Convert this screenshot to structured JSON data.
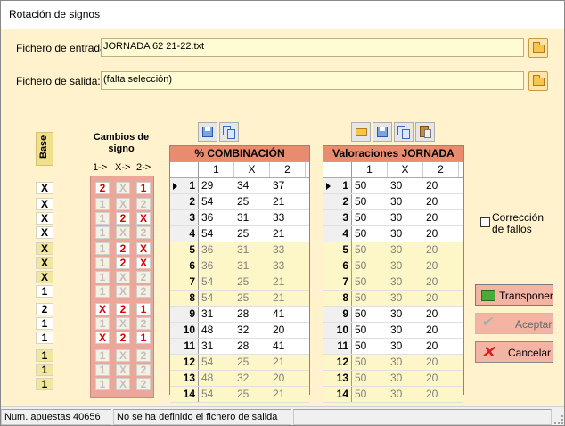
{
  "window": {
    "title": "Rotación de signos"
  },
  "files": {
    "input_label": "Fichero de entrada",
    "input_value": "JORNADA 62 21-22.txt",
    "output_label": "Fichero de salida:",
    "output_value": "(falta selección)"
  },
  "base": {
    "header": "Base",
    "values": [
      "X",
      "X",
      "X",
      "X",
      "X",
      "X",
      "X",
      "1",
      "2",
      "1",
      "1",
      "1",
      "1",
      "1"
    ]
  },
  "changes": {
    "header": "Cambios de signo",
    "col_labels": [
      "1->",
      "X->",
      "2->"
    ],
    "rows": [
      [
        "2",
        "X",
        "1"
      ],
      [
        "1",
        "X",
        "2"
      ],
      [
        "1",
        "2",
        "X"
      ],
      [
        "1",
        "X",
        "2"
      ],
      [
        "1",
        "2",
        "X"
      ],
      [
        "1",
        "2",
        "X"
      ],
      [
        "1",
        "X",
        "2"
      ],
      [
        "1",
        "X",
        "2"
      ],
      [
        "X",
        "2",
        "1"
      ],
      [
        "1",
        "X",
        "2"
      ],
      [
        "X",
        "2",
        "1"
      ],
      [
        "1",
        "X",
        "2"
      ],
      [
        "1",
        "X",
        "2"
      ],
      [
        "1",
        "X",
        "2"
      ]
    ],
    "active": [
      [
        true,
        false,
        true
      ],
      [
        false,
        false,
        false
      ],
      [
        false,
        true,
        true
      ],
      [
        false,
        false,
        false
      ],
      [
        false,
        true,
        true
      ],
      [
        false,
        true,
        true
      ],
      [
        false,
        false,
        false
      ],
      [
        false,
        false,
        false
      ],
      [
        true,
        true,
        true
      ],
      [
        false,
        false,
        false
      ],
      [
        true,
        true,
        true
      ],
      [
        false,
        false,
        false
      ],
      [
        false,
        false,
        false
      ],
      [
        false,
        false,
        false
      ]
    ]
  },
  "combo": {
    "title": "% COMBINACIÓN",
    "cols": [
      "1",
      "X",
      "2"
    ],
    "rows": [
      [
        "1",
        "29",
        "34",
        "37"
      ],
      [
        "2",
        "54",
        "25",
        "21"
      ],
      [
        "3",
        "36",
        "31",
        "33"
      ],
      [
        "4",
        "54",
        "25",
        "21"
      ],
      [
        "5",
        "36",
        "31",
        "33"
      ],
      [
        "6",
        "36",
        "31",
        "33"
      ],
      [
        "7",
        "54",
        "25",
        "21"
      ],
      [
        "8",
        "54",
        "25",
        "21"
      ],
      [
        "9",
        "31",
        "28",
        "41"
      ],
      [
        "10",
        "48",
        "32",
        "20"
      ],
      [
        "11",
        "31",
        "28",
        "41"
      ],
      [
        "12",
        "54",
        "25",
        "21"
      ],
      [
        "13",
        "48",
        "32",
        "20"
      ],
      [
        "14",
        "54",
        "25",
        "21"
      ]
    ]
  },
  "valor": {
    "title": "Valoraciones  JORNADA",
    "cols": [
      "1",
      "X",
      "2"
    ],
    "rows": [
      [
        "1",
        "50",
        "30",
        "20"
      ],
      [
        "2",
        "50",
        "30",
        "20"
      ],
      [
        "3",
        "50",
        "30",
        "20"
      ],
      [
        "4",
        "50",
        "30",
        "20"
      ],
      [
        "5",
        "50",
        "30",
        "20"
      ],
      [
        "6",
        "50",
        "30",
        "20"
      ],
      [
        "7",
        "50",
        "30",
        "20"
      ],
      [
        "8",
        "50",
        "30",
        "20"
      ],
      [
        "9",
        "50",
        "30",
        "20"
      ],
      [
        "10",
        "50",
        "30",
        "20"
      ],
      [
        "11",
        "50",
        "30",
        "20"
      ],
      [
        "12",
        "50",
        "30",
        "20"
      ],
      [
        "13",
        "50",
        "30",
        "20"
      ],
      [
        "14",
        "50",
        "30",
        "20"
      ]
    ]
  },
  "options": {
    "correccion_label": "Corrección de fallos",
    "correccion_checked": false
  },
  "buttons": {
    "transponer": "Transponer",
    "aceptar": "Aceptar",
    "cancelar": "Cancelar"
  },
  "status": {
    "apuestas": "Num. apuestas 40656",
    "message": "No se ha definido el fichero de salida"
  }
}
